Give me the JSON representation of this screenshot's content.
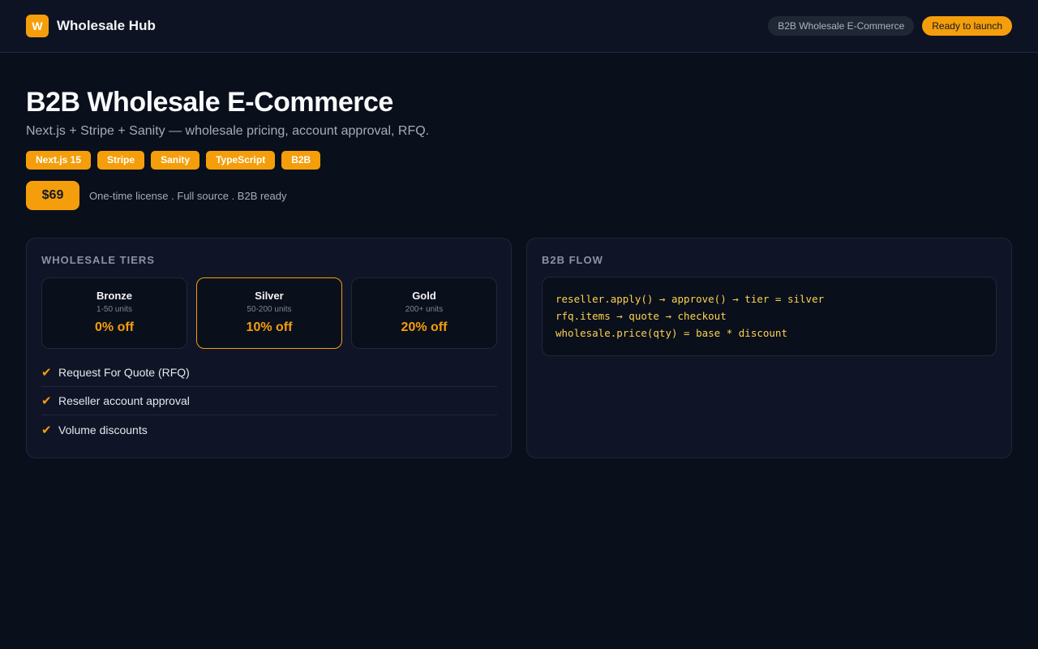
{
  "header": {
    "logo_letter": "W",
    "brand": "Wholesale Hub",
    "badge_category": "B2B Wholesale E-Commerce",
    "badge_status": "Ready to launch"
  },
  "hero": {
    "title": "B2B Wholesale E-Commerce",
    "subtitle": "Next.js + Stripe + Sanity — wholesale pricing, account approval, RFQ.",
    "tags": [
      "Next.js 15",
      "Stripe",
      "Sanity",
      "TypeScript",
      "B2B"
    ],
    "price": "$69",
    "price_note": "One-time license . Full source . B2B ready"
  },
  "tiers_card": {
    "title": "WHOLESALE TIERS",
    "tiers": [
      {
        "name": "Bronze",
        "range": "1-50 units",
        "discount": "0% off"
      },
      {
        "name": "Silver",
        "range": "50-200 units",
        "discount": "10% off"
      },
      {
        "name": "Gold",
        "range": "200+ units",
        "discount": "20% off"
      }
    ],
    "selected_tier": "Silver",
    "features": [
      "Request For Quote (RFQ)",
      "Reseller account approval",
      "Volume discounts"
    ]
  },
  "flow_card": {
    "title": "B2B FLOW",
    "code_lines": [
      "reseller.apply() → approve() → tier = silver",
      "rfq.items → quote → checkout",
      "wholesale.price(qty) = base * discount"
    ]
  },
  "colors": {
    "accent": "#f59e0b",
    "background": "#0a0f1c",
    "card": "#0f1527",
    "code_text": "#fcd34d"
  }
}
